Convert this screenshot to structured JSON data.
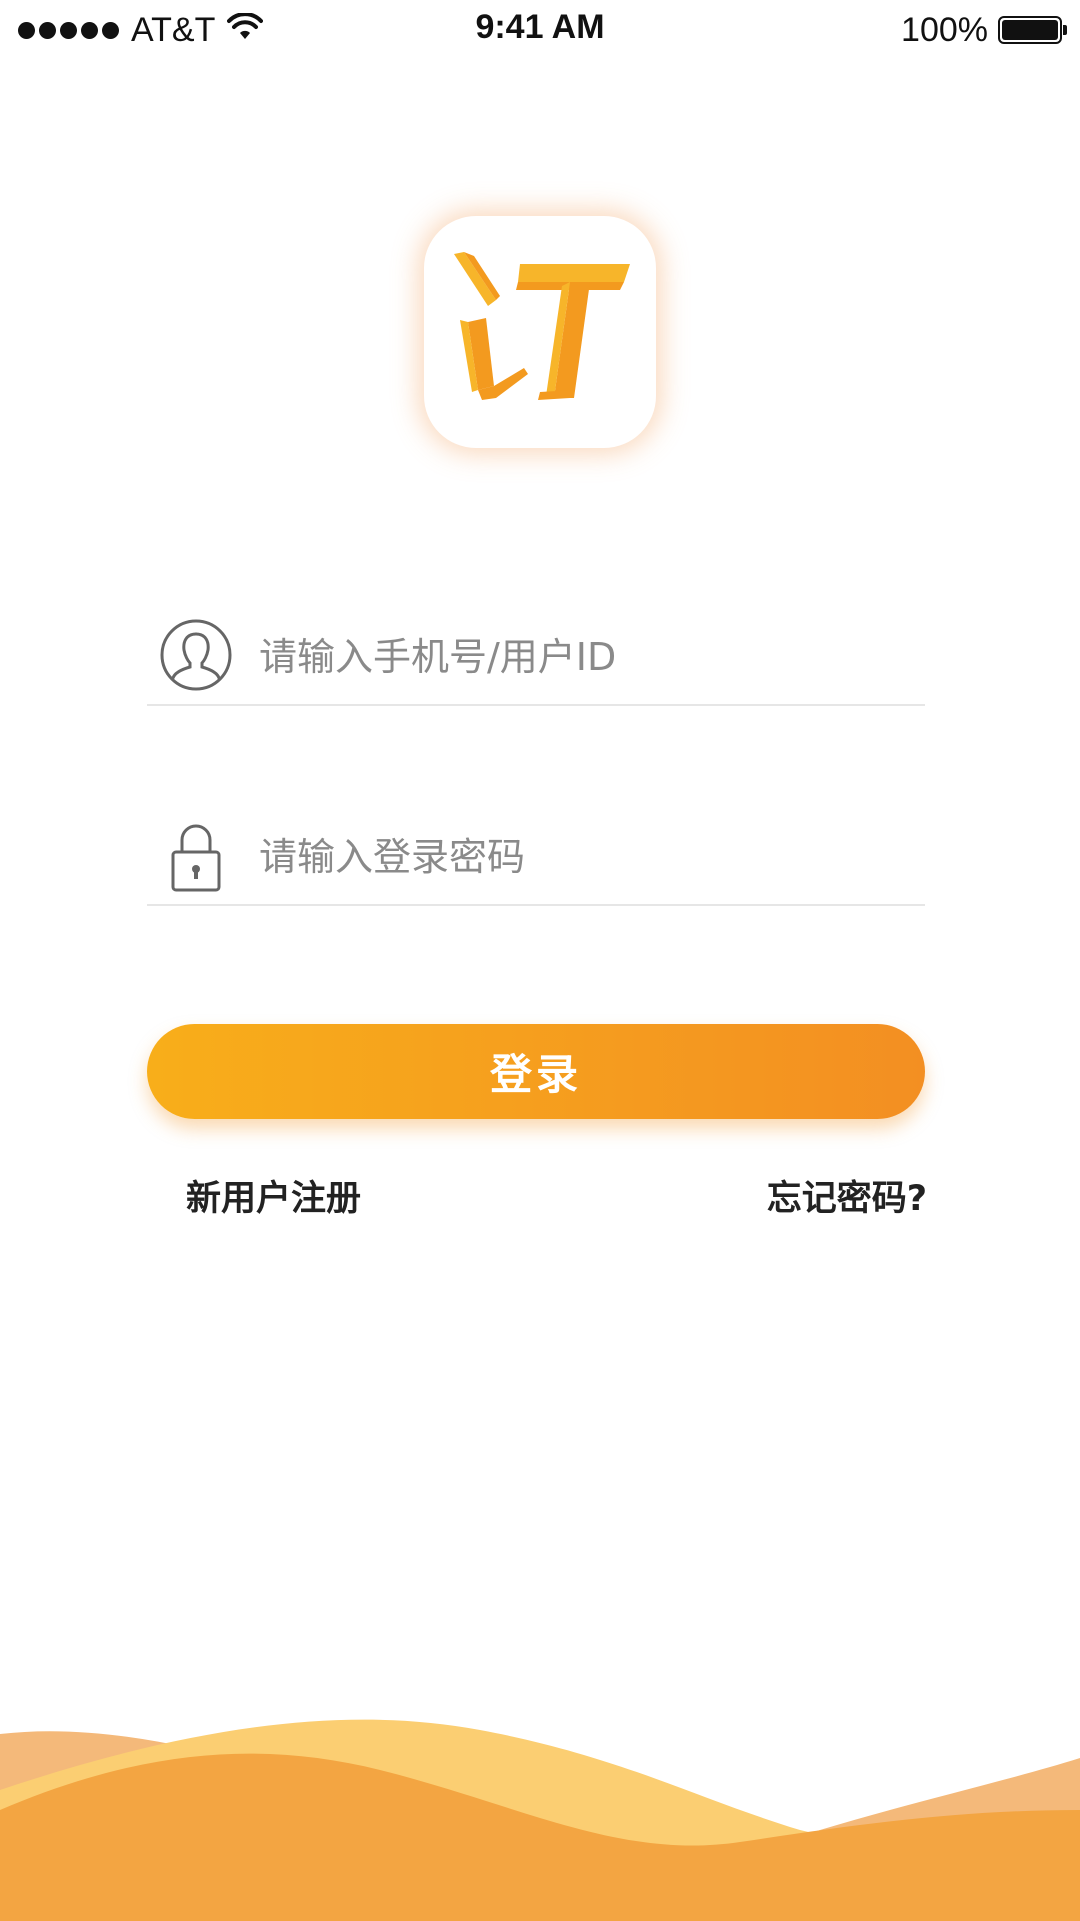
{
  "status_bar": {
    "carrier": "AT&T",
    "time": "9:41 AM",
    "battery_percent_text": "100%",
    "battery_level": 1.0,
    "signal_bars": 5,
    "wifi_icon": "wifi-icon",
    "battery_icon": "battery-icon"
  },
  "logo": {
    "icon": "app-logo-icon",
    "color_primary": "#f39a1f",
    "color_secondary": "#f7b52a"
  },
  "login_form": {
    "username": {
      "icon": "user-avatar-icon",
      "placeholder": "请输入手机号/用户ID",
      "value": ""
    },
    "password": {
      "icon": "lock-icon",
      "placeholder": "请输入登录密码",
      "value": ""
    },
    "submit_label": "登录",
    "button_gradient": [
      "#f8ae1a",
      "#f38f22"
    ]
  },
  "links": {
    "register": "新用户注册",
    "forgot_password": "忘记密码?"
  },
  "decoration": {
    "wave_colors": [
      "#f4b97a",
      "#fbce72",
      "#f3a542"
    ]
  }
}
